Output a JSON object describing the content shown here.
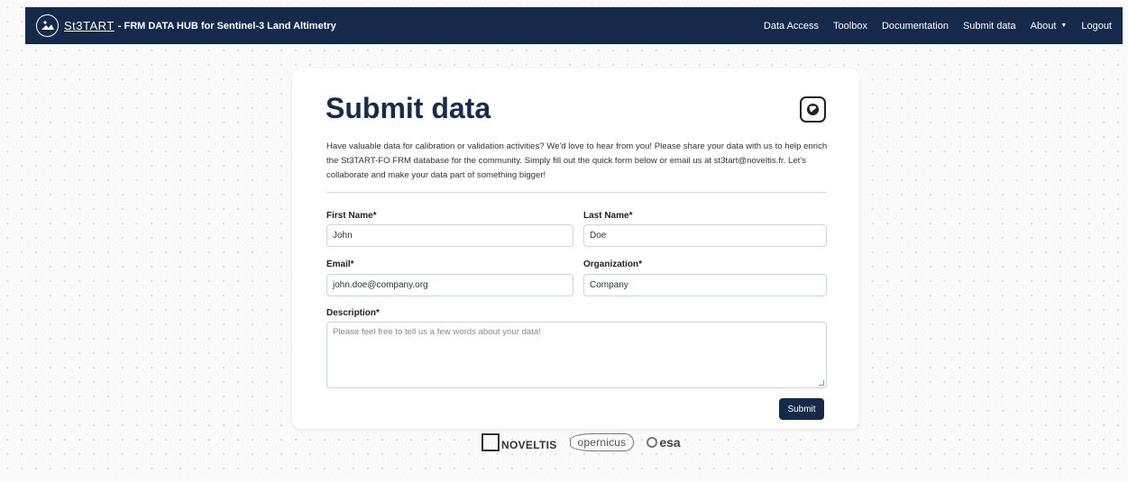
{
  "header": {
    "brand": "St3TART",
    "subtitle": "- FRM DATA HUB for Sentinel-3 Land Altimetry",
    "nav": [
      {
        "label": "Data Access"
      },
      {
        "label": "Toolbox"
      },
      {
        "label": "Documentation"
      },
      {
        "label": "Submit data"
      },
      {
        "label": "About"
      },
      {
        "label": "Logout"
      }
    ]
  },
  "main": {
    "title": "Submit data",
    "intro": "Have valuable data for calibration or validation activities? We'd love to hear from you! Please share your data with us to help enrich the St3TART-FO FRM database for the community. Simply fill out the quick form below or email us at st3tart@noveltis.fr. Let's collaborate and make your data part of something bigger!",
    "form": {
      "first_name_label": "First Name*",
      "first_name_value": "John",
      "last_name_label": "Last Name*",
      "last_name_value": "Doe",
      "email_label": "Email*",
      "email_value": "john.doe@company.org",
      "organization_label": "Organization*",
      "organization_value": "Company",
      "description_label": "Description*",
      "description_placeholder": "Please feel free to tell us a few words about your data!",
      "submit_label": "Submit"
    }
  },
  "partners": {
    "noveltis": "NOVELTIS",
    "copernicus": "opernicus",
    "esa": "esa"
  },
  "colors": {
    "navy": "#15294a",
    "title": "#172b4d"
  },
  "icons": {
    "brand": "satellite-logo-icon",
    "theme": "theme-toggle-icon",
    "about_caret": "caret-down-icon"
  }
}
